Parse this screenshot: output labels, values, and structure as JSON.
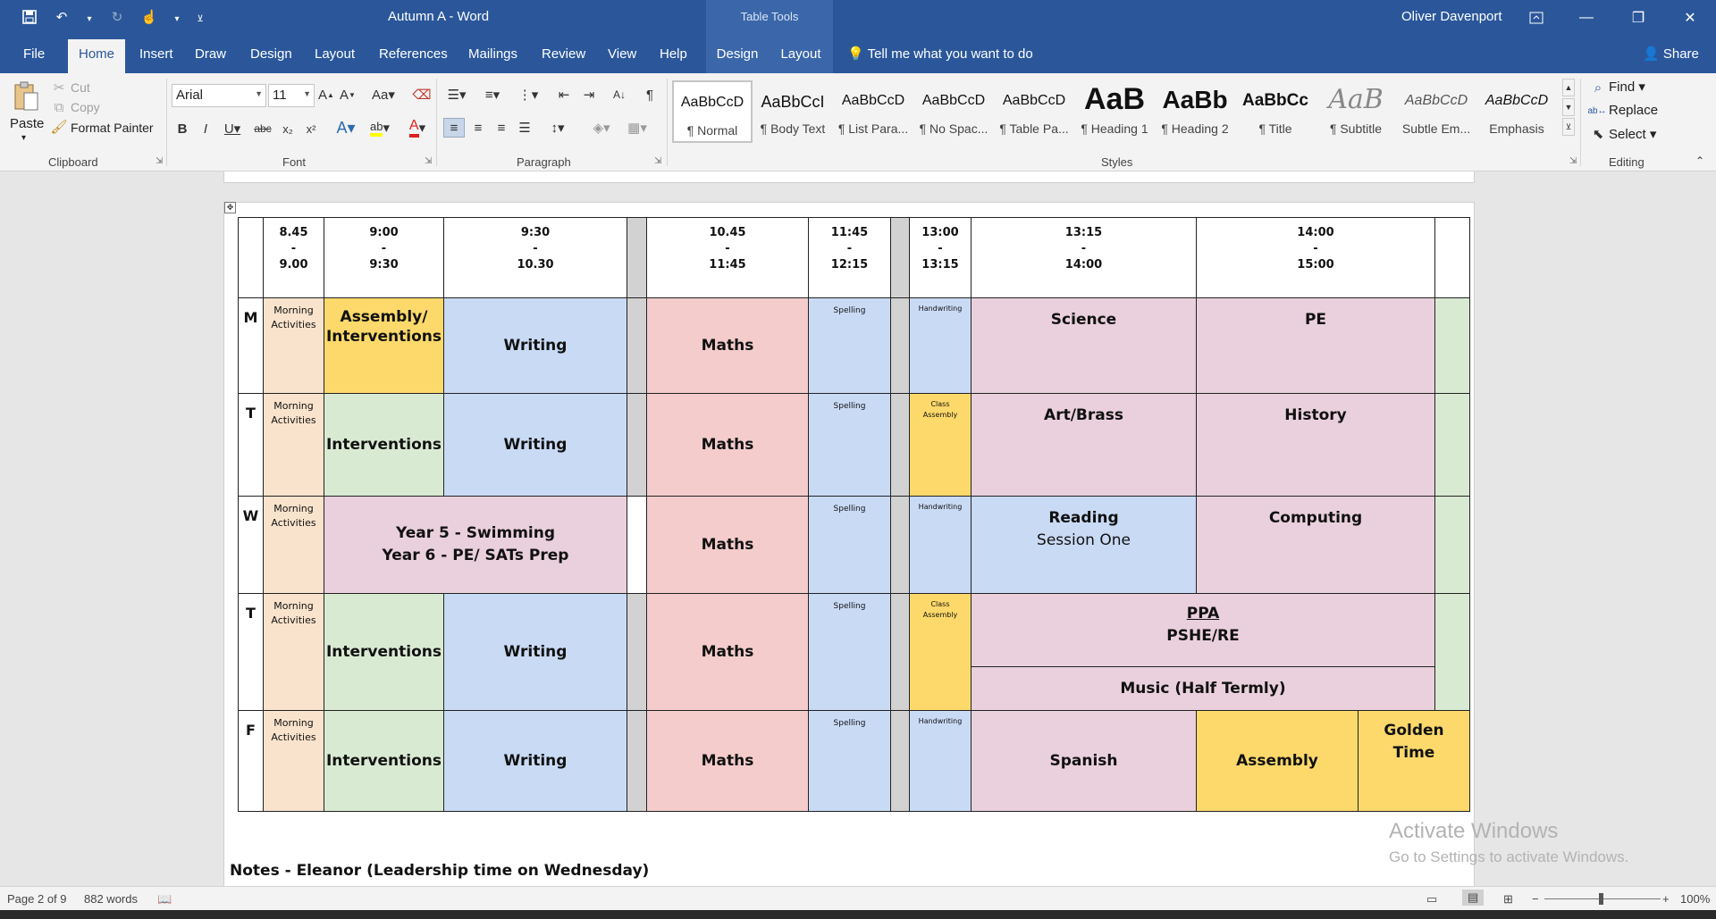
{
  "titlebar": {
    "doc_title": "Autumn A  -  Word",
    "contextual": "Table Tools",
    "user": "Oliver Davenport"
  },
  "tabs": [
    "File",
    "Home",
    "Insert",
    "Draw",
    "Design",
    "Layout",
    "References",
    "Mailings",
    "Review",
    "View",
    "Help",
    "Design",
    "Layout"
  ],
  "tell_me": "Tell me what you want to do",
  "share": "Share",
  "clipboard": {
    "paste": "Paste",
    "cut": "Cut",
    "copy": "Copy",
    "format_painter": "Format Painter",
    "label": "Clipboard"
  },
  "font": {
    "family": "Arial",
    "size": "11",
    "label": "Font"
  },
  "paragraph": {
    "label": "Paragraph"
  },
  "styles": {
    "label": "Styles",
    "items": [
      {
        "sample": "AaBbCcD",
        "name": "¶ Normal"
      },
      {
        "sample": "AaBbCcI",
        "name": "¶ Body Text"
      },
      {
        "sample": "AaBbCcD",
        "name": "¶ List Para..."
      },
      {
        "sample": "AaBbCcD",
        "name": "¶ No Spac..."
      },
      {
        "sample": "AaBbCcD",
        "name": "¶ Table Pa..."
      },
      {
        "sample": "AaB",
        "name": "¶ Heading 1"
      },
      {
        "sample": "AaBb",
        "name": "¶ Heading 2"
      },
      {
        "sample": "AaBbCc",
        "name": "¶ Title"
      },
      {
        "sample": "AaB",
        "name": "¶ Subtitle"
      },
      {
        "sample": "AaBbCcD",
        "name": "Subtle Em..."
      },
      {
        "sample": "AaBbCcD",
        "name": "Emphasis"
      }
    ]
  },
  "editing": {
    "find": "Find",
    "replace": "Replace",
    "select": "Select",
    "label": "Editing"
  },
  "timetable": {
    "times": [
      [
        "8.45",
        "-",
        "9.00"
      ],
      [
        "9:00",
        "-",
        "9:30"
      ],
      [
        "9:30",
        "-",
        "10.30"
      ],
      [
        "10.45",
        "-",
        "11:45"
      ],
      [
        "11:45",
        "-",
        "12:15"
      ],
      [
        "13:00",
        "-",
        "13:15"
      ],
      [
        "13:15",
        "-",
        "14:00"
      ],
      [
        "14:00",
        "-",
        "15:00"
      ]
    ],
    "days": [
      "M",
      "T",
      "W",
      "T",
      "F"
    ],
    "morning": [
      "Morning",
      "Activities"
    ],
    "spelling": "Spelling",
    "handwriting": "Handwriting",
    "class_assembly": [
      "Class",
      "Assembly"
    ],
    "mon": {
      "slot1": [
        "Assembly/",
        "Interventions"
      ],
      "writing": "Writing",
      "maths": "Maths",
      "pm1": "Science",
      "pm2": "PE"
    },
    "tue": {
      "slot1": "Interventions",
      "writing": "Writing",
      "maths": "Maths",
      "pm1": "Art/Brass",
      "pm2": "History"
    },
    "wed": {
      "swim": [
        "Year 5 - Swimming",
        "Year 6 - PE/ SATs Prep"
      ],
      "maths": "Maths",
      "pm1": [
        "Reading",
        "Session One"
      ],
      "pm2": "Computing"
    },
    "thu": {
      "slot1": "Interventions",
      "writing": "Writing",
      "maths": "Maths",
      "ppa": "PPA",
      "pshe": "PSHE/RE",
      "music": "Music (Half Termly)"
    },
    "fri": {
      "slot1": "Interventions",
      "writing": "Writing",
      "maths": "Maths",
      "pm1": "Spanish",
      "pm2": "Assembly",
      "pm3": [
        "Golden",
        "Time"
      ]
    }
  },
  "notes": "Notes - Eleanor (Leadership time on Wednesday)",
  "watermark": {
    "line1": "Activate Windows",
    "line2": "Go to Settings to activate Windows."
  },
  "status": {
    "page": "Page 2 of 9",
    "words": "882 words",
    "zoom": "100%"
  }
}
